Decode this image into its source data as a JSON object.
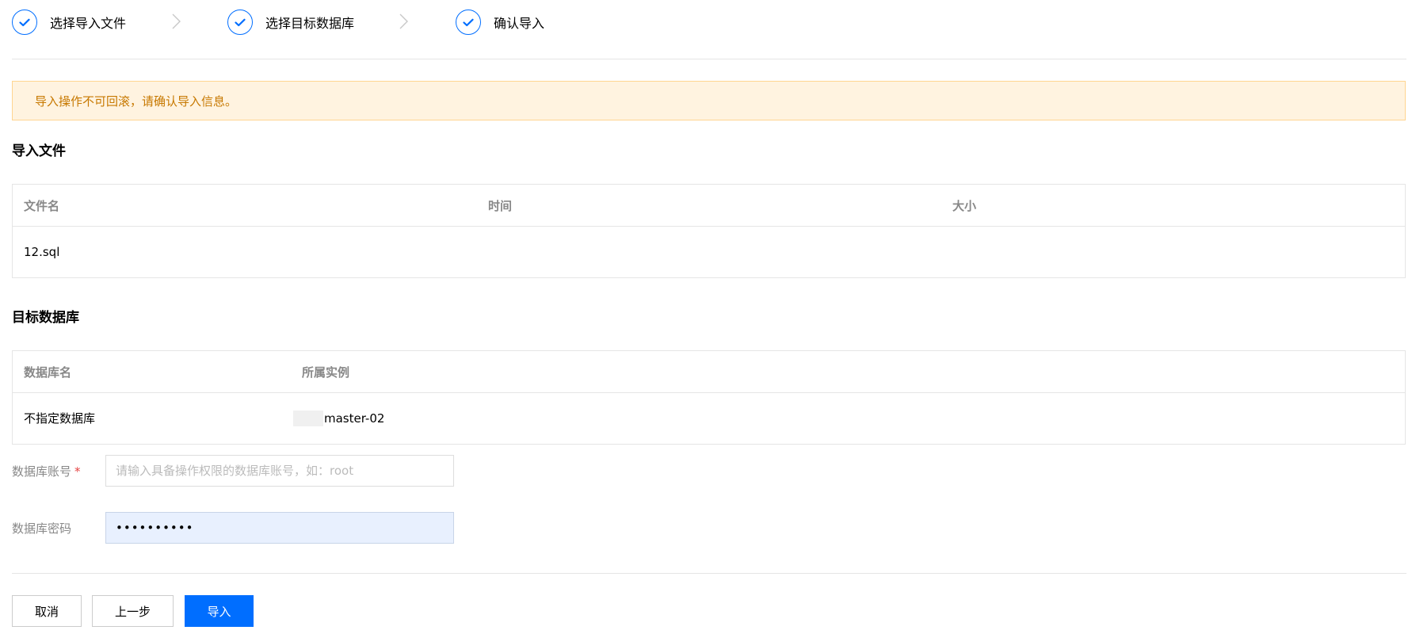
{
  "steps": [
    {
      "label": "选择导入文件",
      "icon": "check-icon",
      "status": "done"
    },
    {
      "label": "选择目标数据库",
      "icon": "check-icon",
      "status": "done"
    },
    {
      "label": "确认导入",
      "icon": "check-icon",
      "status": "done"
    }
  ],
  "alert": {
    "text": "导入操作不可回滚，请确认导入信息。"
  },
  "import_file": {
    "title": "导入文件",
    "columns": [
      "文件名",
      "时间",
      "大小"
    ],
    "rows": [
      [
        "12.sql",
        "",
        ""
      ]
    ]
  },
  "target_db": {
    "title": "目标数据库",
    "columns": [
      "数据库名",
      "所属实例"
    ],
    "rows": [
      [
        "不指定数据库",
        "master-02"
      ]
    ]
  },
  "form": {
    "account": {
      "label": "数据库账号",
      "required_mark": "*",
      "value": "",
      "placeholder": "请输入具备操作权限的数据库账号，如：root"
    },
    "password": {
      "label": "数据库密码",
      "value": "••••••••••"
    }
  },
  "buttons": {
    "cancel": "取消",
    "prev": "上一步",
    "import": "导入"
  },
  "colors": {
    "accent": "#006eff",
    "alert_bg": "#fff3e0",
    "alert_text": "#c77800",
    "required": "#e54545"
  }
}
